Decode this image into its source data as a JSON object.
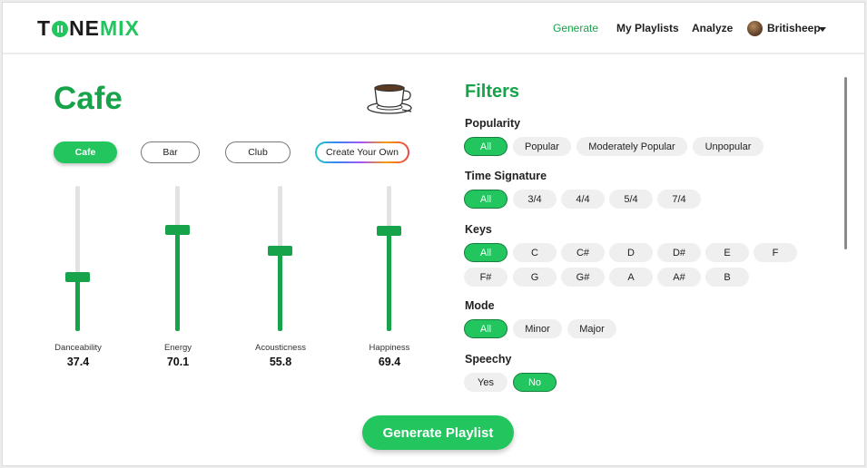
{
  "brand": {
    "logo_prefix": "T",
    "logo_mid": "NE",
    "logo_suffix": "MIX"
  },
  "nav": {
    "generate": "Generate",
    "playlists": "My Playlists",
    "analyze": "Analyze",
    "user": "Britisheep"
  },
  "mood": {
    "title": "Cafe"
  },
  "presets": [
    "Cafe",
    "Bar",
    "Club",
    "Create Your Own"
  ],
  "sliders": [
    {
      "label": "Danceability",
      "value": "37.4",
      "level": 0.374
    },
    {
      "label": "Energy",
      "value": "70.1",
      "level": 0.701
    },
    {
      "label": "Acousticness",
      "value": "55.8",
      "level": 0.558
    },
    {
      "label": "Happiness",
      "value": "69.4",
      "level": 0.694
    }
  ],
  "filters": {
    "title": "Filters",
    "popularity": {
      "label": "Popularity",
      "options": [
        "All",
        "Popular",
        "Moderately Popular",
        "Unpopular"
      ],
      "selected": "All"
    },
    "time_signature": {
      "label": "Time Signature",
      "options": [
        "All",
        "3/4",
        "4/4",
        "5/4",
        "7/4"
      ],
      "selected": "All"
    },
    "keys": {
      "label": "Keys",
      "options": [
        "All",
        "C",
        "C#",
        "D",
        "D#",
        "E",
        "F",
        "F#",
        "G",
        "G#",
        "A",
        "A#",
        "B"
      ],
      "selected": "All"
    },
    "mode": {
      "label": "Mode",
      "options": [
        "All",
        "Minor",
        "Major"
      ],
      "selected": "All"
    },
    "speechy": {
      "label": "Speechy",
      "options": [
        "Yes",
        "No"
      ],
      "selected": "No"
    }
  },
  "actions": {
    "generate_playlist": "Generate Playlist"
  },
  "colors": {
    "accent": "#22c55e",
    "accent_dark": "#16a34a"
  }
}
